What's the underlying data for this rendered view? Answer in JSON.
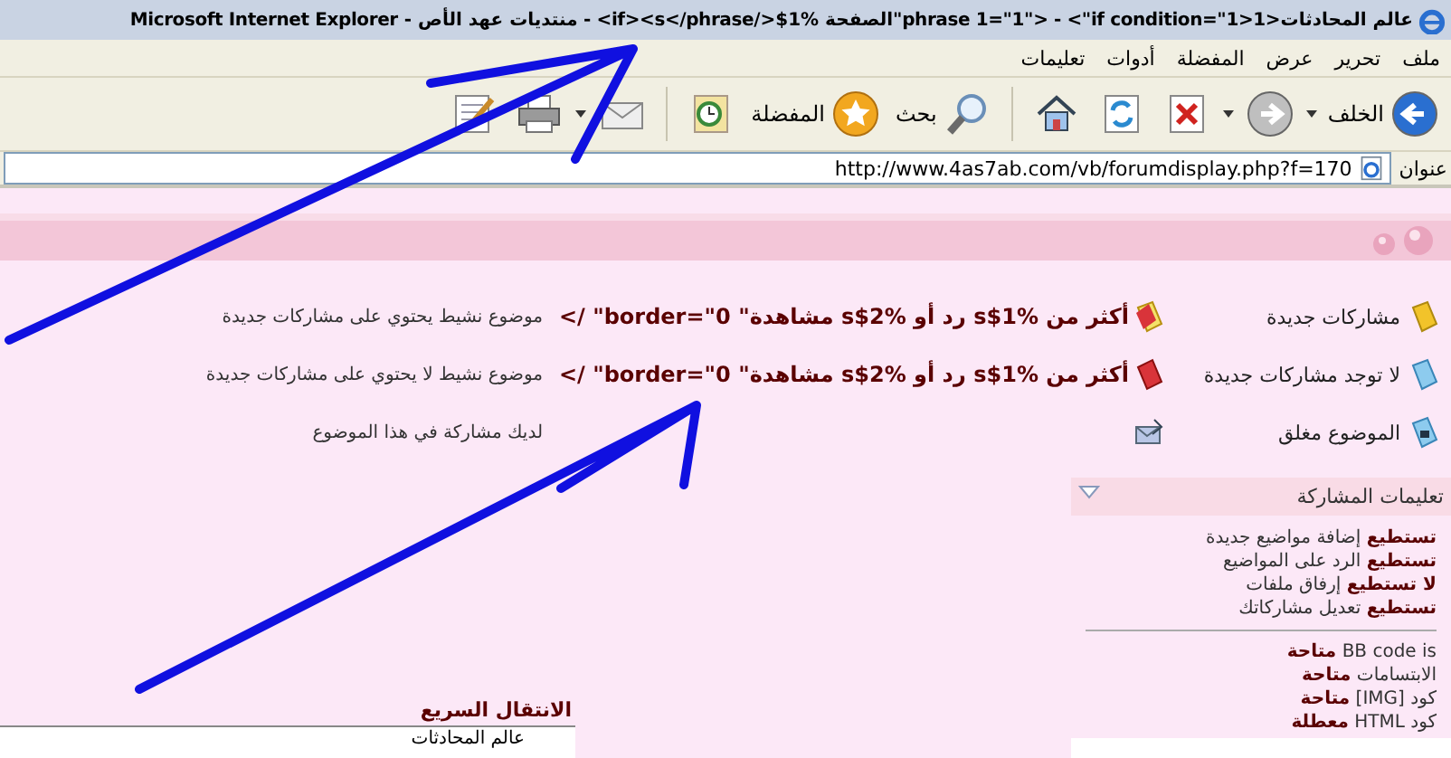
{
  "window": {
    "title": "عالم المحادثات<phrase 1=\"1\"> - <\"if condition=\"1>1\"الصفحة %1$</if><s</phrase> - منتديات عهد الأص - Microsoft Internet Explorer"
  },
  "menu": [
    "ملف",
    "تحرير",
    "عرض",
    "المفضلة",
    "أدوات",
    "تعليمات"
  ],
  "toolbar": [
    {
      "kind": "back",
      "label": "الخلف",
      "dropdown": true
    },
    {
      "kind": "forward",
      "dropdown": true
    },
    {
      "kind": "stop"
    },
    {
      "kind": "refresh"
    },
    {
      "kind": "home"
    },
    {
      "kind": "search",
      "label": "بحث"
    },
    {
      "kind": "favorites",
      "label": "المفضلة"
    },
    {
      "kind": "history"
    },
    {
      "kind": "mail",
      "dropdown": true
    },
    {
      "kind": "print"
    },
    {
      "kind": "edit"
    }
  ],
  "address": {
    "label": "عنوان",
    "value": "http://www.4as7ab.com/vb/forumdisplay.php?f=170"
  },
  "legend": [
    {
      "kind": "new",
      "label": "مشاركات جديدة",
      "marker": {
        "kind": "hot-new"
      },
      "hot_text": "أكثر من %1$s رد أو %2$s مشاهدة\" border=\"0\" />",
      "description": "موضوع نشيط يحتوي على مشاركات جديدة"
    },
    {
      "kind": "old",
      "label": "لا توجد مشاركات جديدة",
      "marker": {
        "kind": "hot-old"
      },
      "hot_text": "أكثر من %1$s رد أو %2$s مشاهدة\" border=\"0\" />",
      "description": "موضوع نشيط لا يحتوي على مشاركات جديدة"
    },
    {
      "kind": "locked",
      "label": "الموضوع مغلق",
      "marker": {
        "kind": "posted"
      },
      "description": "لديك مشاركة في هذا الموضوع"
    }
  ],
  "posting_rules": {
    "title": "تعليمات المشاركة",
    "rules": [
      "**تستطيع** إضافة مواضيع جديدة",
      "**تستطيع** الرد على المواضيع",
      "**لا تستطيع** إرفاق ملفات",
      "**تستطيع** تعديل مشاركاتك"
    ],
    "settings": [
      "BB code is **متاحة**",
      "الابتسامات **متاحة**",
      "كود [IMG] **متاحة**",
      "كود HTML **معطلة**"
    ]
  },
  "quick_nav": {
    "title": "الانتقال السريع",
    "value": "عالم المحادثات"
  }
}
